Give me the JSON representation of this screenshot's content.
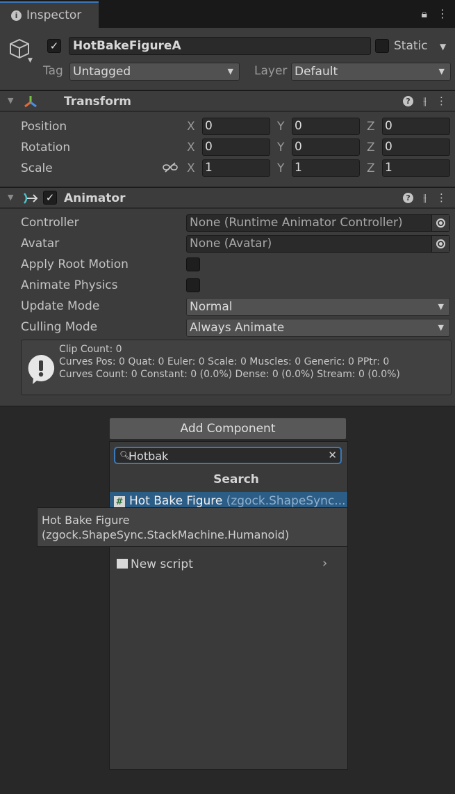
{
  "tab": {
    "title": "Inspector"
  },
  "object": {
    "name": "HotBakeFigureA",
    "active": true,
    "static_label": "Static",
    "tag_label": "Tag",
    "tag_value": "Untagged",
    "layer_label": "Layer",
    "layer_value": "Default"
  },
  "transform": {
    "title": "Transform",
    "rows": [
      {
        "label": "Position",
        "x": "0",
        "y": "0",
        "z": "0"
      },
      {
        "label": "Rotation",
        "x": "0",
        "y": "0",
        "z": "0"
      },
      {
        "label": "Scale",
        "x": "1",
        "y": "1",
        "z": "1"
      }
    ],
    "axis_x": "X",
    "axis_y": "Y",
    "axis_z": "Z"
  },
  "animator": {
    "title": "Animator",
    "enabled": true,
    "controller_label": "Controller",
    "controller_value": "None (Runtime Animator Controller)",
    "avatar_label": "Avatar",
    "avatar_value": "None (Avatar)",
    "apply_root_motion_label": "Apply Root Motion",
    "animate_physics_label": "Animate Physics",
    "update_mode_label": "Update Mode",
    "update_mode_value": "Normal",
    "culling_mode_label": "Culling Mode",
    "culling_mode_value": "Always Animate",
    "info_lines": [
      "Clip Count: 0",
      "Curves Pos: 0 Quat: 0 Euler: 0 Scale: 0 Muscles: 0 Generic: 0 PPtr: 0",
      "Curves Count: 0 Constant: 0 (0.0%) Dense: 0 (0.0%) Stream: 0 (0.0%)"
    ]
  },
  "add_component": {
    "button_label": "Add Component",
    "search_value": "Hotbak",
    "popup_title": "Search",
    "result_name": "Hot Bake Figure",
    "result_namespace": "(zgock.ShapeSync...",
    "new_script_label": "New script",
    "tooltip_line1": "Hot Bake Figure",
    "tooltip_line2": "(zgock.ShapeSync.StackMachine.Humanoid)"
  }
}
